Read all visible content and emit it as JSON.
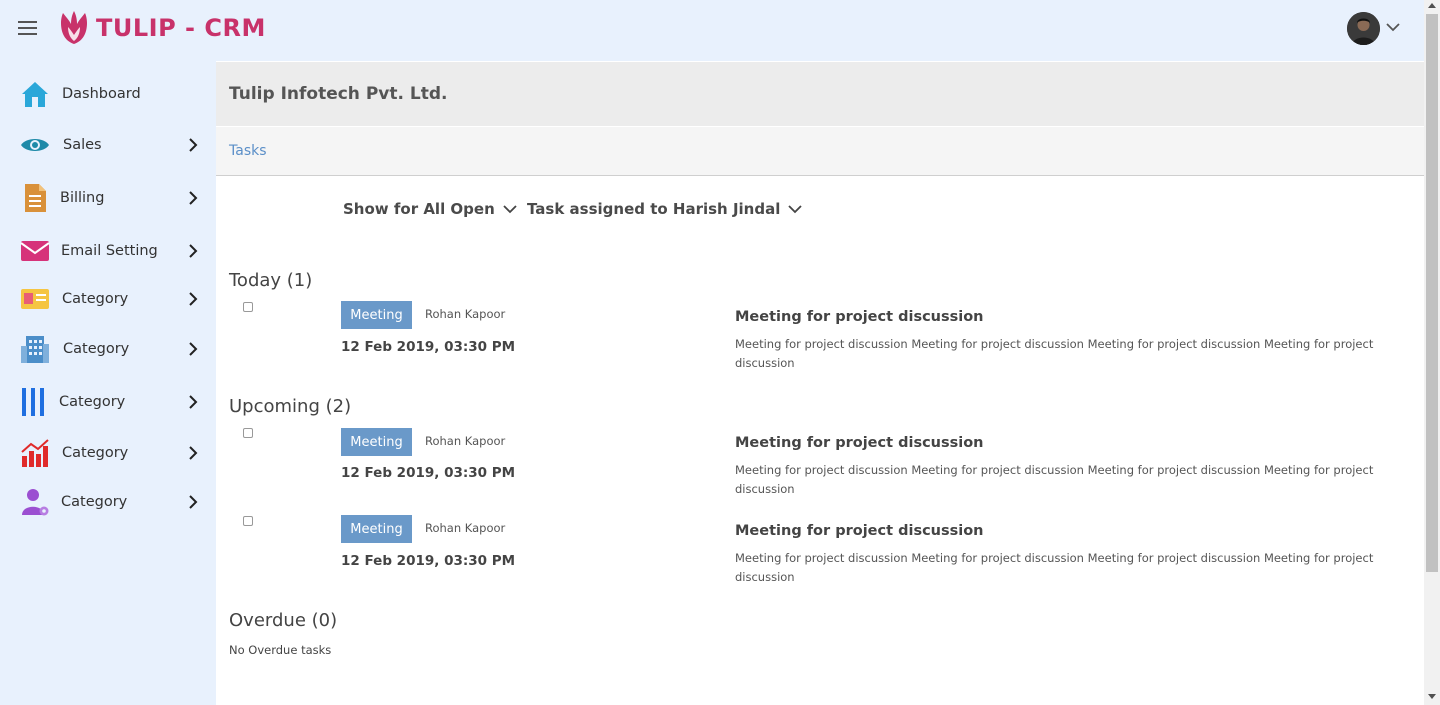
{
  "app": {
    "logo_text": "TULIP - CRM"
  },
  "sidebar": {
    "items": [
      {
        "label": "Dashboard",
        "icon": "home-icon"
      },
      {
        "label": "Sales",
        "icon": "eye-icon"
      },
      {
        "label": "Billing",
        "icon": "billing-document-icon"
      },
      {
        "label": "Email Setting",
        "icon": "envelope-icon"
      },
      {
        "label": "Category",
        "icon": "id-card-icon"
      },
      {
        "label": "Category",
        "icon": "building-icon"
      },
      {
        "label": "Category",
        "icon": "bars-icon"
      },
      {
        "label": "Category",
        "icon": "chart-icon"
      },
      {
        "label": "Category",
        "icon": "user-settings-icon"
      }
    ]
  },
  "main": {
    "company": "Tulip Infotech Pvt. Ltd.",
    "breadcrumb": "Tasks",
    "filters": {
      "status": "Show for All Open",
      "assignee": "Task assigned to Harish Jindal"
    },
    "sections": {
      "today": {
        "title": "Today (1)",
        "tasks": [
          {
            "type": "Meeting",
            "assignee": "Rohan Kapoor",
            "datetime": "12 Feb 2019, 03:30 PM",
            "title": "Meeting for project discussion",
            "description": "Meeting for project discussion Meeting for project discussion Meeting for project discussion Meeting for project discussion"
          }
        ]
      },
      "upcoming": {
        "title": "Upcoming (2)",
        "tasks": [
          {
            "type": "Meeting",
            "assignee": "Rohan Kapoor",
            "datetime": "12 Feb 2019, 03:30 PM",
            "title": "Meeting for project discussion",
            "description": "Meeting for project discussion Meeting for project discussion Meeting for project discussion Meeting for project discussion"
          },
          {
            "type": "Meeting",
            "assignee": "Rohan Kapoor",
            "datetime": "12 Feb 2019, 03:30 PM",
            "title": "Meeting for project discussion",
            "description": "Meeting for project discussion Meeting for project discussion Meeting for project discussion Meeting for project discussion"
          }
        ]
      },
      "overdue": {
        "title": "Overdue (0)",
        "empty_text": "No Overdue tasks"
      }
    }
  },
  "colors": {
    "brand": "#c8326a",
    "sidebar_bg": "#e8f1fd",
    "badge": "#6a99c9",
    "link": "#5b8fc8"
  }
}
